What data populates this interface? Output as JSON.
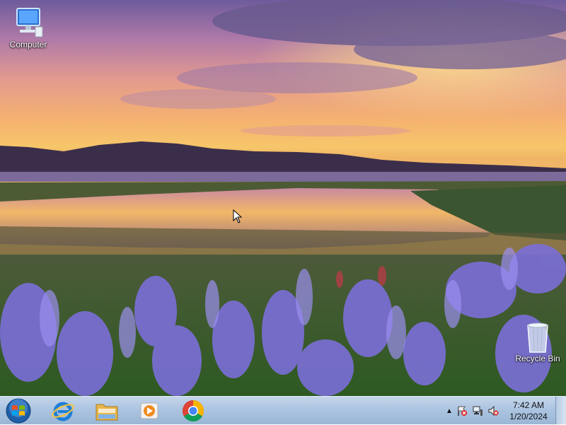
{
  "desktop": {
    "icons": [
      {
        "label": "Computer",
        "icon": "computer-icon"
      },
      {
        "label": "Recycle Bin",
        "icon": "recycle-bin-icon"
      }
    ]
  },
  "taskbar": {
    "start": {
      "icon": "windows-start-orb-icon"
    },
    "pinned": [
      {
        "icon": "internet-explorer-icon"
      },
      {
        "icon": "file-explorer-icon"
      },
      {
        "icon": "media-player-icon"
      },
      {
        "icon": "chrome-icon"
      }
    ],
    "tray": {
      "chevron": "▲",
      "icons": [
        "action-center-flag-icon",
        "network-icon",
        "volume-muted-icon"
      ],
      "time": "7:42 AM",
      "date": "1/20/2024"
    }
  },
  "colors": {
    "taskbar": "#aac3e0",
    "sky_top": "#6e5b9c",
    "sunset": "#f6c66a",
    "flowers": "#7b6fd8",
    "grass": "#3f6b2a"
  }
}
